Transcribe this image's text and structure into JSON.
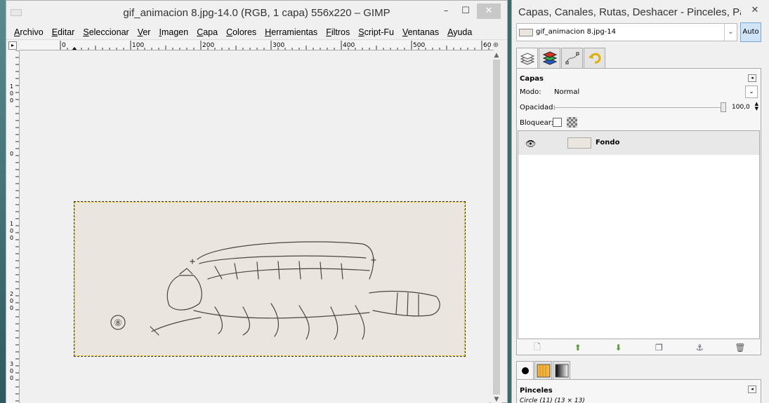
{
  "image_window": {
    "title": "gif_animacion 8.jpg-14.0 (RGB, 1 capa) 556x220 – GIMP",
    "controls": {
      "minimize": "–",
      "maximize": "☐",
      "close": "✕"
    },
    "menu": [
      "Archivo",
      "Editar",
      "Seleccionar",
      "Ver",
      "Imagen",
      "Capa",
      "Colores",
      "Herramientas",
      "Filtros",
      "Script-Fu",
      "Ventanas",
      "Ayuda"
    ],
    "ruler_top_labels": [
      "0",
      "100",
      "200",
      "300",
      "400",
      "500",
      "60"
    ],
    "ruler_left_labels": [
      "1\n0\n0",
      "0",
      "1\n0\n0",
      "2\n0\n0",
      "3\n0\n0"
    ],
    "image_caption": "⑧"
  },
  "dock": {
    "title": "Capas, Canales, Rutas, Deshacer - Pinceles, Patr…",
    "close": "✕",
    "image_selector": "gif_animacion 8.jpg-14",
    "auto_label": "Auto",
    "layers": {
      "title": "Capas",
      "mode_label": "Modo:",
      "mode_value": "Normal",
      "opacity_label": "Opacidad:",
      "opacity_value": "100,0",
      "lock_label": "Bloquear:",
      "items": [
        {
          "name": "Fondo",
          "visible": true
        }
      ]
    },
    "brushes": {
      "title": "Pinceles",
      "current": "Circle (11) (13 × 13)"
    }
  }
}
